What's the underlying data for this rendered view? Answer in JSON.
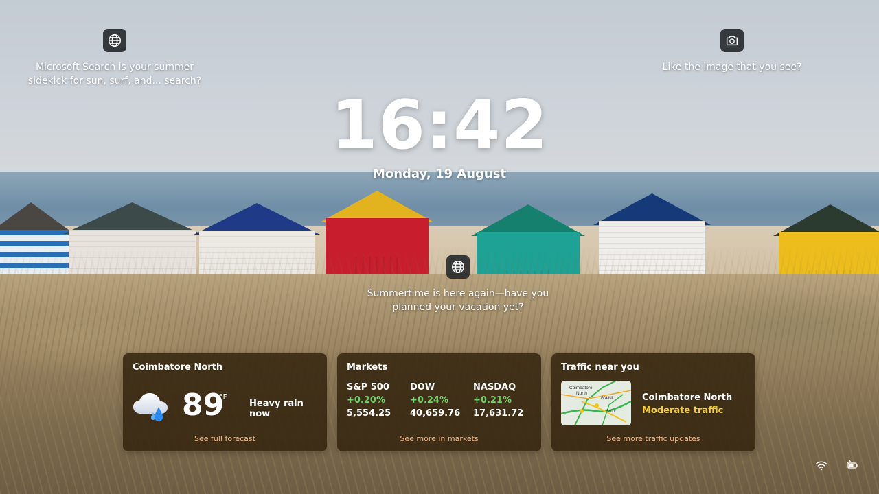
{
  "spotlight": {
    "left": {
      "icon": "globe-icon",
      "text_line1": "Microsoft Search is your summer",
      "text_line2": "sidekick for sun, surf, and... search?"
    },
    "right": {
      "icon": "camera-icon",
      "text": "Like the image that you see?"
    },
    "center": {
      "icon": "globe-icon",
      "text_line1": "Summertime is here again—have you",
      "text_line2": "planned your vacation yet?"
    }
  },
  "clock": {
    "time": "16:42",
    "date": "Monday, 19 August"
  },
  "weather": {
    "title": "Coimbatore North",
    "icon": "rain-cloud-icon",
    "temperature": "89",
    "unit": "°F",
    "condition": "Heavy rain now",
    "link": "See full forecast"
  },
  "markets": {
    "title": "Markets",
    "items": [
      {
        "name": "S&P 500",
        "change": "+0.20%",
        "value": "5,554.25"
      },
      {
        "name": "DOW",
        "change": "+0.24%",
        "value": "40,659.76"
      },
      {
        "name": "NASDAQ",
        "change": "+0.21%",
        "value": "17,631.72"
      }
    ],
    "link": "See more in markets"
  },
  "traffic": {
    "title": "Traffic near you",
    "map_labels": [
      "Coimbatore",
      "North",
      "Arasur",
      "Sulur"
    ],
    "place": "Coimbatore North",
    "status": "Moderate traffic",
    "link": "See more traffic updates",
    "status_color": "#f3cf3b"
  },
  "tray": {
    "icons": [
      "wifi-icon",
      "power-plug-icon"
    ]
  }
}
